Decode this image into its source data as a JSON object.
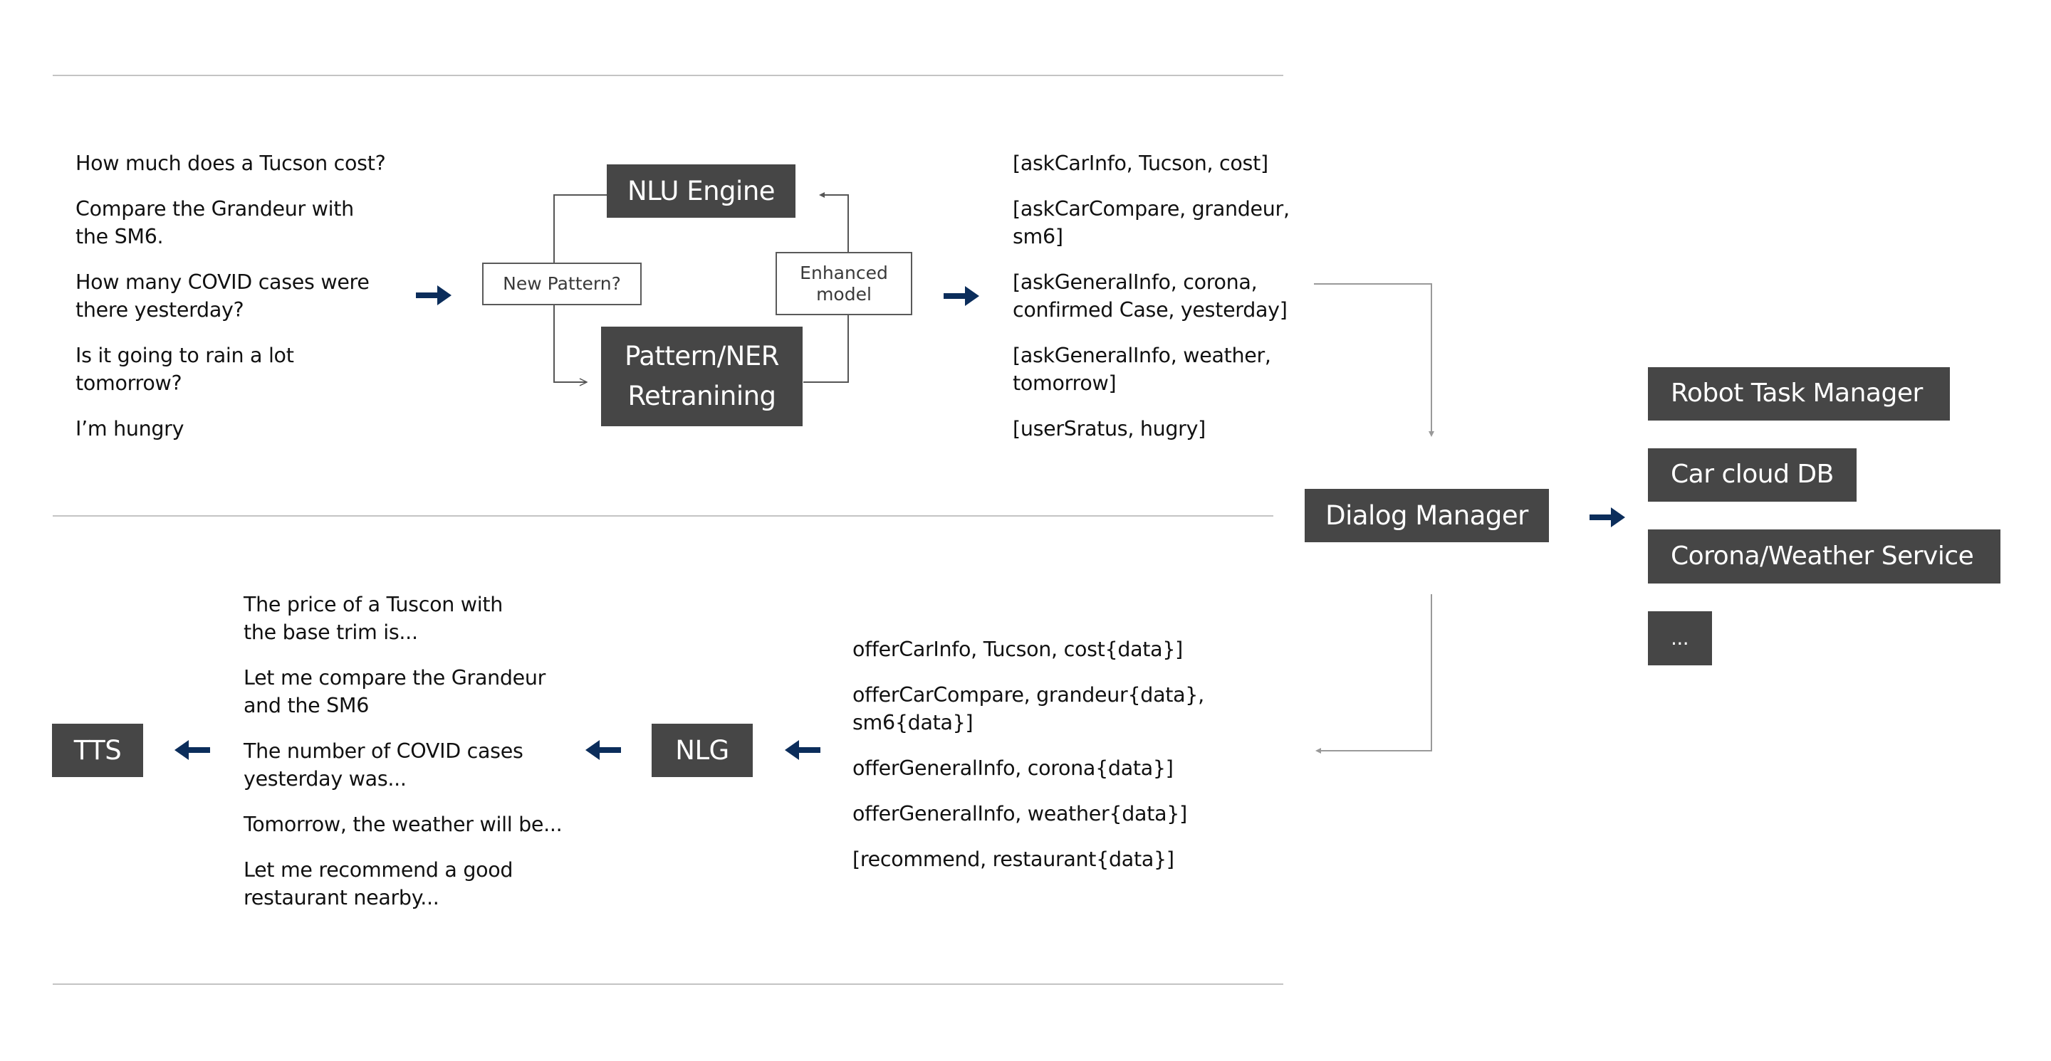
{
  "colors": {
    "box_fill": "#464646",
    "box_text": "#ffffff",
    "flow_arrow": "#0b2d5b",
    "connector": "#999999",
    "rule": "#c4c4c4"
  },
  "user_utterances": [
    "How much does a Tucson cost?",
    "Compare the Grandeur with\nthe SM6.",
    "How many COVID cases were\nthere yesterday?",
    "Is it going to rain a lot\ntomorrow?",
    "I’m hungry"
  ],
  "nlu_loop": {
    "engine": "NLU Engine",
    "new_pattern": "New Pattern?",
    "retraining": "Pattern/NER\nRetranining",
    "enhanced_model": "Enhanced\nmodel"
  },
  "intents": [
    "[askCarInfo, Tucson, cost]",
    "[askCarCompare, grandeur,\nsm6]",
    "[askGeneralInfo, corona,\nconfirmed Case, yesterday]",
    "[askGeneralInfo, weather,\ntomorrow]",
    "[userSratus, hugry]"
  ],
  "dialog_manager": "Dialog Manager",
  "services": [
    "Robot Task Manager",
    "Car cloud DB",
    "Corona/Weather Service",
    "..."
  ],
  "offers": [
    "offerCarInfo, Tucson, cost{data}]",
    "offerCarCompare, grandeur{data},\nsm6{data}]",
    "offerGeneralInfo, corona{data}]",
    "offerGeneralInfo, weather{data}]",
    "[recommend, restaurant{data}]"
  ],
  "nlg": "NLG",
  "responses": [
    "The price of a Tuscon with\nthe base trim is...",
    "Let me compare the Grandeur\nand the SM6",
    "The number of COVID cases\nyesterday was...",
    "Tomorrow, the weather will be...",
    "Let me recommend a good\nrestaurant nearby..."
  ],
  "tts": "TTS"
}
